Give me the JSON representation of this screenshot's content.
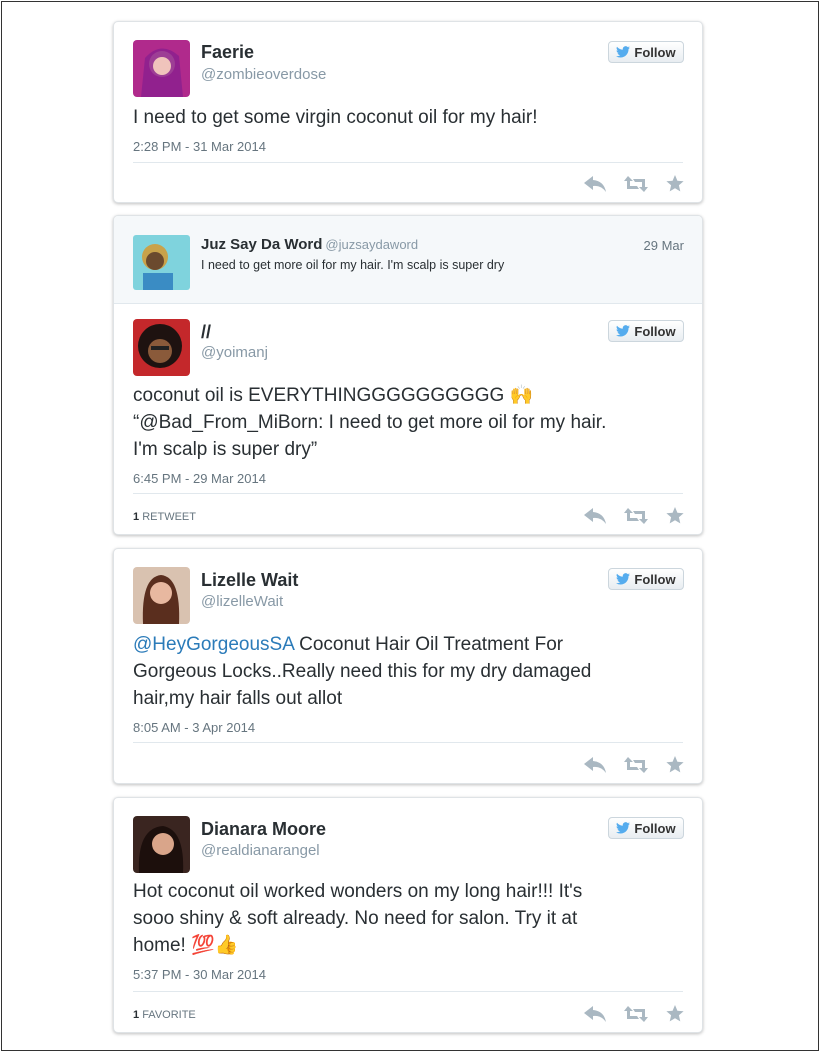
{
  "colors": {
    "link": "#2b7bb9",
    "twitter_bird": "#55acee",
    "muted": "#8899a6",
    "action_icons": "#aab8c2"
  },
  "tweets": [
    {
      "name": "Faerie",
      "handle": "@zombieoverdose",
      "follow_label": "Follow",
      "text": "I need to get some virgin coconut oil for my hair!",
      "timestamp": "2:28 PM - 31 Mar 2014"
    },
    {
      "quoted": {
        "name": "Juz Say Da Word",
        "handle": "@juzsaydaword",
        "date": "29 Mar",
        "text": "I need to get more oil for my hair. I'm scalp is super dry"
      },
      "name": "//",
      "handle": "@yoimanj",
      "follow_label": "Follow",
      "text_line1": "coconut oil is EVERYTHINGGGGGGGGGG 🙌",
      "text_line2": "“@Bad_From_MiBorn: I need to get more oil for my hair.",
      "text_line3": "I'm scalp is super dry”",
      "timestamp": "6:45 PM - 29 Mar 2014",
      "stat_count": "1",
      "stat_label": "RETWEET"
    },
    {
      "name": "Lizelle Wait",
      "handle": "@lizelleWait",
      "follow_label": "Follow",
      "mention": "@HeyGorgeousSA",
      "text_line1_rest": " Coconut Hair Oil Treatment For",
      "text_line2": "Gorgeous Locks..Really need this for my dry damaged",
      "text_line3": "hair,my hair falls out allot",
      "timestamp": "8:05 AM - 3 Apr 2014"
    },
    {
      "name": "Dianara Moore",
      "handle": "@realdianarangel",
      "follow_label": "Follow",
      "text_line1": "Hot coconut oil worked wonders on my long hair!!! It's",
      "text_line2": "sooo shiny & soft already. No need for salon. Try it at",
      "text_line3": "home! 💯👍",
      "timestamp": "5:37 PM - 30 Mar 2014",
      "stat_count": "1",
      "stat_label": "FAVORITE"
    }
  ],
  "icons": {
    "reply": "reply-icon",
    "retweet": "retweet-icon",
    "favorite": "star-icon",
    "follow": "twitter-bird-icon"
  }
}
